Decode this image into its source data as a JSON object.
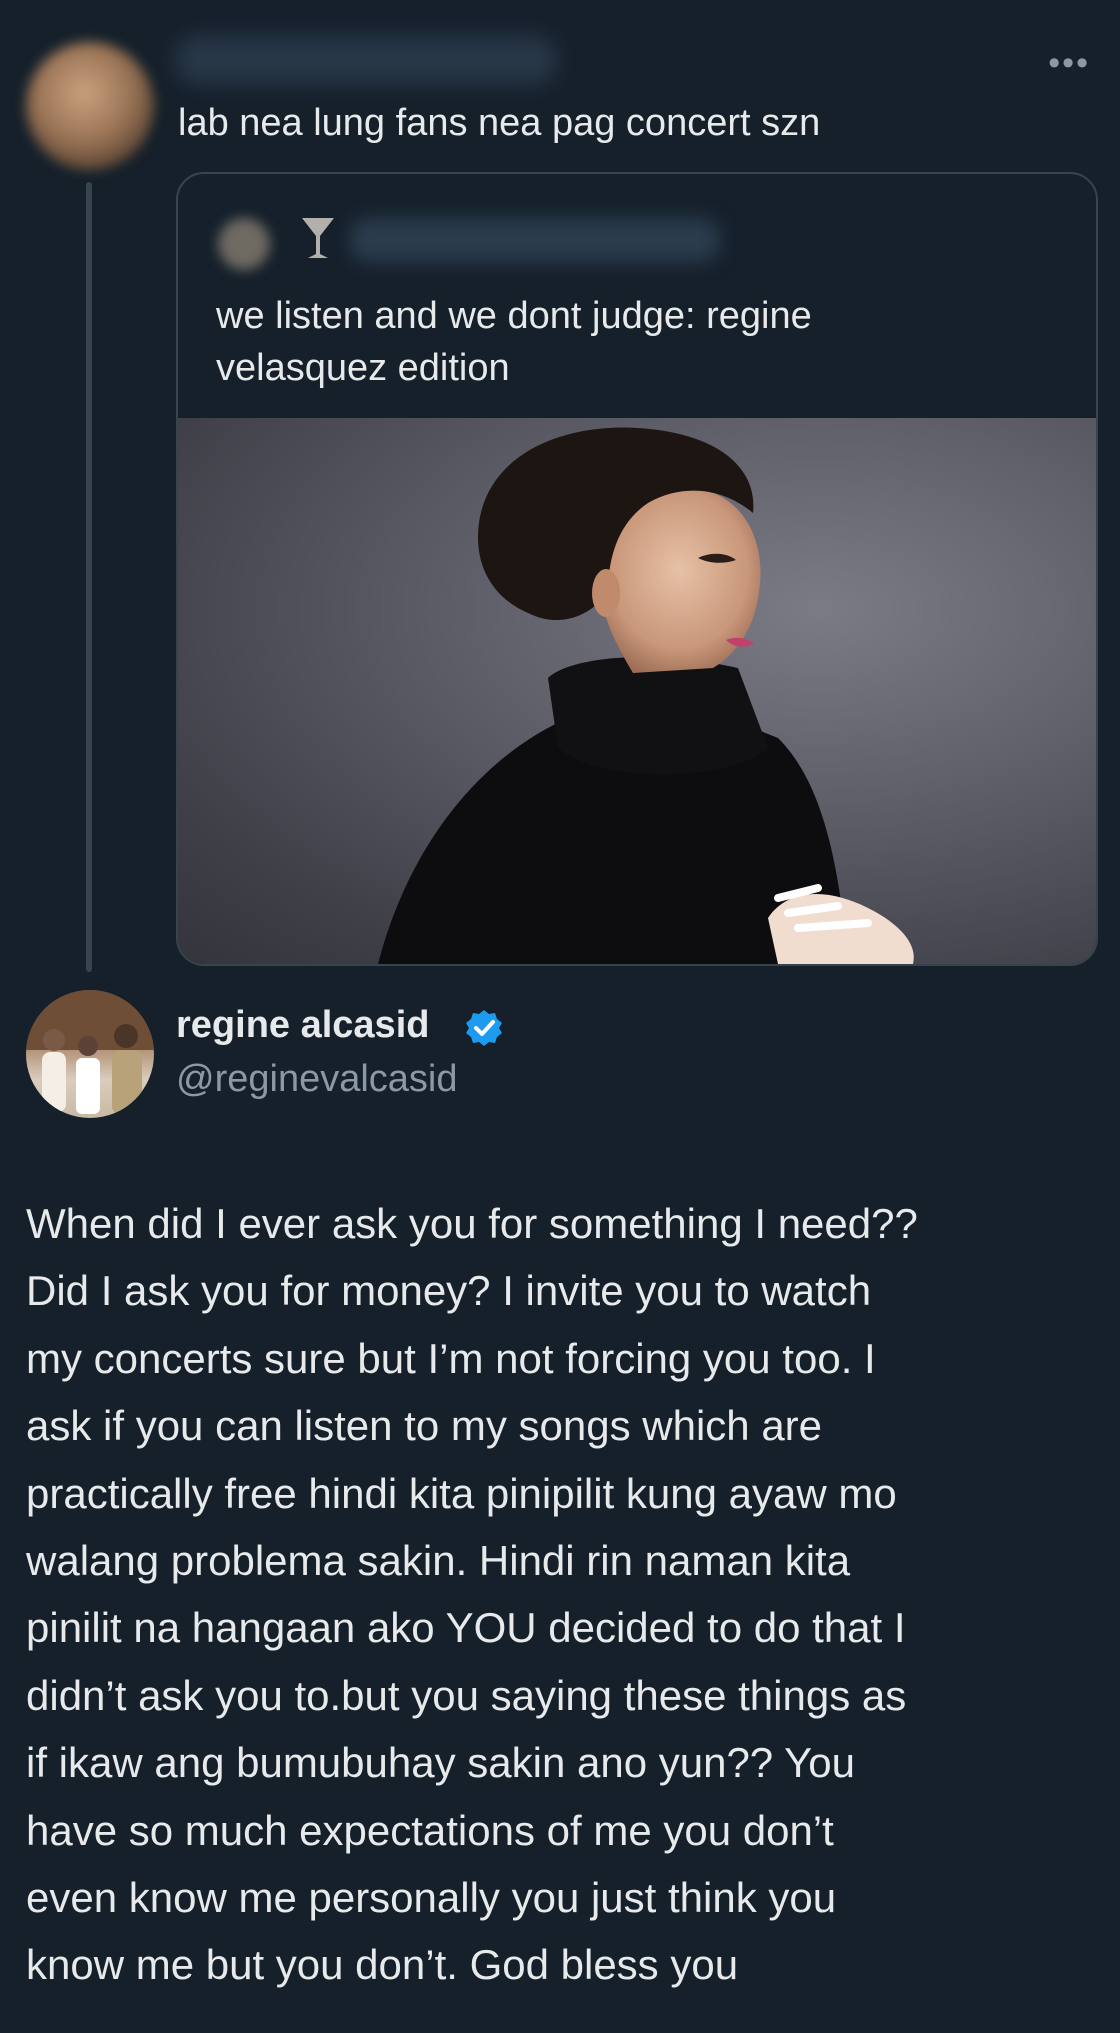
{
  "top_tweet": {
    "avatar_icon": "blurred-avatar-icon",
    "more_icon": "more-options-icon",
    "more_label": "•••",
    "text": "lab nea lung fans nea pag concert szn"
  },
  "quoted_tweet": {
    "avatar_icon": "blurred-avatar-icon",
    "emoji_icon": "cocktail-glass-icon",
    "text_lines": [
      "we listen and we dont judge: regine",
      "velasquez edition"
    ],
    "photo_icon": "portrait-photo"
  },
  "reply_tweet": {
    "avatar_icon": "family-photo-avatar",
    "display_name": "regine alcasid",
    "verified_icon": "verified-badge-icon",
    "handle": "@reginevalcasid",
    "body_lines": [
      "When did I ever ask you for something I need??",
      "Did I ask you for money? I invite you to watch",
      "my concerts sure but I’m not forcing you too. I",
      "ask if you can listen to my songs which are",
      "practically free hindi kita pinipilit kung ayaw mo",
      "walang problema sakin. Hindi rin naman kita",
      "pinilit na hangaan ako YOU decided to do that I",
      "didn’t ask you to.but you saying these things as",
      "if ikaw ang bumubuhay sakin ano yun?? You",
      "have so much expectations of me you don’t",
      "even know me personally you just think you",
      "know me but you don’t. God bless you"
    ]
  },
  "colors": {
    "background": "#15202b",
    "text": "#e7e9ea",
    "secondary_text": "#8b98a5",
    "border": "#38444d",
    "verified_blue": "#1d9bf0"
  }
}
